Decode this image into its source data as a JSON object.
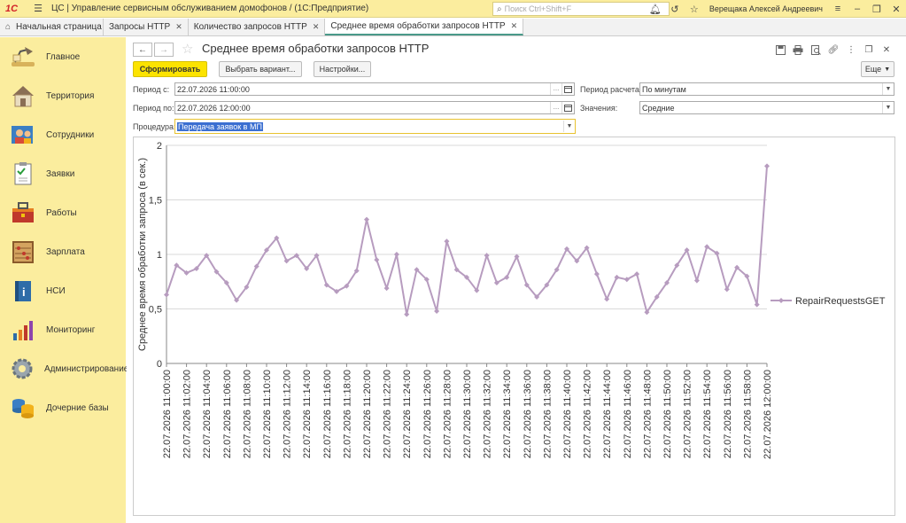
{
  "topbar": {
    "logo_text": "1С",
    "app_title": "ЦС | Управление сервисным обслуживанием домофонов /  (1С:Предприятие)",
    "search_placeholder": "Поиск Ctrl+Shift+F",
    "user": "Верещака Алексей Андреевич"
  },
  "tabs": [
    {
      "label": "Начальная страница"
    },
    {
      "label": "Запросы HTTP"
    },
    {
      "label": "Количество запросов HTTP"
    },
    {
      "label": "Среднее время обработки запросов HTTP"
    }
  ],
  "sidebar": {
    "items": [
      {
        "label": "Главное",
        "icon": "desk-lamp-icon"
      },
      {
        "label": "Территория",
        "icon": "house-icon"
      },
      {
        "label": "Сотрудники",
        "icon": "employees-icon"
      },
      {
        "label": "Заявки",
        "icon": "clipboard-icon"
      },
      {
        "label": "Работы",
        "icon": "tools-icon"
      },
      {
        "label": "Зарплата",
        "icon": "abacus-icon"
      },
      {
        "label": "НСИ",
        "icon": "info-book-icon"
      },
      {
        "label": "Мониторинг",
        "icon": "bar-chart-icon"
      },
      {
        "label": "Администрирование",
        "icon": "gear-icon"
      },
      {
        "label": "Дочерние базы",
        "icon": "databases-icon"
      }
    ]
  },
  "page": {
    "title": "Среднее время обработки запросов HTTP",
    "generate_button": "Сформировать",
    "variant_button": "Выбрать вариант...",
    "settings_button": "Настройки...",
    "more_button": "Еще"
  },
  "filters": {
    "period_from_label": "Период с:",
    "period_from_value": "22.07.2026 11:00:00",
    "period_to_label": "Период по:",
    "period_to_value": "22.07.2026 12:00:00",
    "procedure_label": "Процедура:",
    "procedure_value": "Передача заявок в МП",
    "calc_period_label": "Период расчета:",
    "calc_period_value": "По минутам",
    "values_label": "Значения:",
    "values_value": "Средние"
  },
  "chart_data": {
    "type": "line",
    "ylabel": "Среднее время обработки запроса (в сек.)",
    "ylim": [
      0,
      2
    ],
    "yticks": [
      "0",
      "0,5",
      "1",
      "1,5",
      "2"
    ],
    "grid": true,
    "legend_position": "right",
    "series": [
      {
        "name": "RepairRequestsGET",
        "color": "#b79cbf",
        "values": [
          0.63,
          0.9,
          0.83,
          0.87,
          0.99,
          0.84,
          0.74,
          0.58,
          0.7,
          0.89,
          1.04,
          1.15,
          0.94,
          0.99,
          0.87,
          0.99,
          0.72,
          0.66,
          0.71,
          0.85,
          1.32,
          0.95,
          0.69,
          1.0,
          0.45,
          0.86,
          0.77,
          0.48,
          1.12,
          0.86,
          0.79,
          0.67,
          0.99,
          0.74,
          0.79,
          0.98,
          0.72,
          0.61,
          0.72,
          0.86,
          1.05,
          0.94,
          1.06,
          0.82,
          0.59,
          0.79,
          0.77,
          0.82,
          0.47,
          0.61,
          0.74,
          0.9,
          1.04,
          0.76,
          1.07,
          1.01,
          0.68,
          0.88,
          0.8,
          0.54,
          1.81
        ]
      }
    ],
    "xticks": [
      "22.07.2026 11:00:00",
      "22.07.2026 11:02:00",
      "22.07.2026 11:04:00",
      "22.07.2026 11:06:00",
      "22.07.2026 11:08:00",
      "22.07.2026 11:10:00",
      "22.07.2026 11:12:00",
      "22.07.2026 11:14:00",
      "22.07.2026 11:16:00",
      "22.07.2026 11:18:00",
      "22.07.2026 11:20:00",
      "22.07.2026 11:22:00",
      "22.07.2026 11:24:00",
      "22.07.2026 11:26:00",
      "22.07.2026 11:28:00",
      "22.07.2026 11:30:00",
      "22.07.2026 11:32:00",
      "22.07.2026 11:34:00",
      "22.07.2026 11:36:00",
      "22.07.2026 11:38:00",
      "22.07.2026 11:40:00",
      "22.07.2026 11:42:00",
      "22.07.2026 11:44:00",
      "22.07.2026 11:46:00",
      "22.07.2026 11:48:00",
      "22.07.2026 11:50:00",
      "22.07.2026 11:52:00",
      "22.07.2026 11:54:00",
      "22.07.2026 11:56:00",
      "22.07.2026 11:58:00",
      "22.07.2026 12:00:00"
    ]
  }
}
